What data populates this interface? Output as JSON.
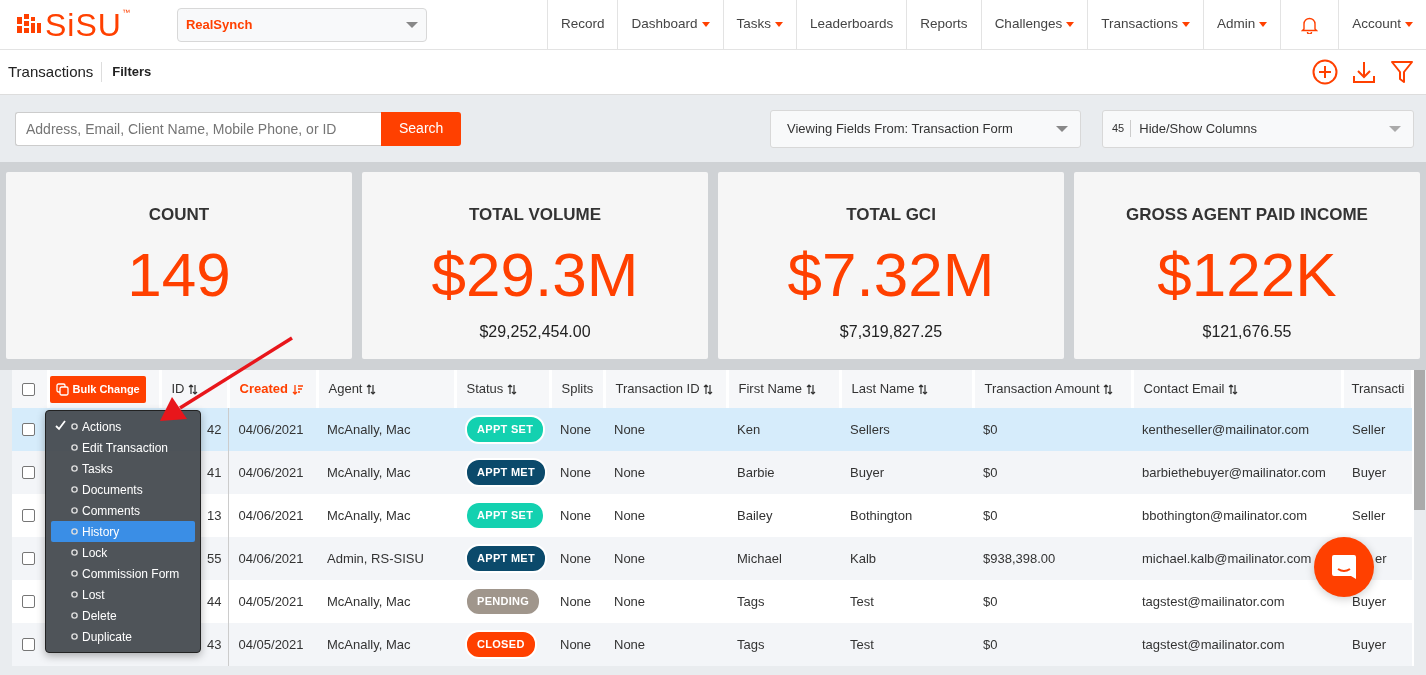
{
  "brand": {
    "logo": "SiSU",
    "trademark": "™"
  },
  "org_select": {
    "value": "RealSynch"
  },
  "nav": [
    {
      "label": "Record",
      "dropdown": false
    },
    {
      "label": "Dashboard",
      "dropdown": true
    },
    {
      "label": "Tasks",
      "dropdown": true
    },
    {
      "label": "Leaderboards",
      "dropdown": false
    },
    {
      "label": "Reports",
      "dropdown": false
    },
    {
      "label": "Challenges",
      "dropdown": true
    },
    {
      "label": "Transactions",
      "dropdown": true
    },
    {
      "label": "Admin",
      "dropdown": true
    },
    {
      "kind": "bell"
    },
    {
      "label": "Account",
      "dropdown": true
    }
  ],
  "subheader": {
    "title": "Transactions",
    "filters": "Filters"
  },
  "search": {
    "placeholder": "Address, Email, Client Name, Mobile Phone, or ID",
    "button": "Search"
  },
  "view_select": {
    "value": "Viewing Fields From: Transaction Form"
  },
  "columns_select": {
    "count": "45",
    "value": "Hide/Show Columns"
  },
  "stats": [
    {
      "label": "COUNT",
      "value": "149"
    },
    {
      "label": "TOTAL VOLUME",
      "value": "$29.3M",
      "detail": "$29,252,454.00"
    },
    {
      "label": "TOTAL GCI",
      "value": "$7.32M",
      "detail": "$7,319,827.25"
    },
    {
      "label": "GROSS AGENT PAID INCOME",
      "value": "$122K",
      "detail": "$121,676.55"
    }
  ],
  "table": {
    "select_all_checked": false,
    "bulk_button": "Bulk Change",
    "columns": [
      {
        "label": "ID",
        "sortable": true,
        "sorted": false
      },
      {
        "label": "Created",
        "sortable": true,
        "sorted": true
      },
      {
        "label": "Agent",
        "sortable": true,
        "sorted": false
      },
      {
        "label": "Status",
        "sortable": true,
        "sorted": false
      },
      {
        "label": "Splits",
        "sortable": false,
        "sorted": false
      },
      {
        "label": "Transaction ID",
        "sortable": true,
        "sorted": false
      },
      {
        "label": "First Name",
        "sortable": true,
        "sorted": false
      },
      {
        "label": "Last Name",
        "sortable": true,
        "sorted": false
      },
      {
        "label": "Transaction Amount",
        "sortable": true,
        "sorted": false
      },
      {
        "label": "Contact Email",
        "sortable": true,
        "sorted": false
      },
      {
        "label": "Transacti",
        "sortable": false,
        "sorted": false
      }
    ],
    "rows": [
      {
        "selected": true,
        "checked": false,
        "cells": [
          "42",
          "04/06/2021",
          "McAnally, Mac",
          {
            "label": "APPT SET",
            "color": "#13d1b0"
          },
          "None",
          "None",
          "Ken",
          "Sellers",
          "$0",
          "kentheseller@mailinator.com",
          "Seller"
        ]
      },
      {
        "selected": false,
        "checked": false,
        "cells": [
          "41",
          "04/06/2021",
          "McAnally, Mac",
          {
            "label": "APPT MET",
            "color": "#0b4a6b"
          },
          "None",
          "None",
          "Barbie",
          "Buyer",
          "$0",
          "barbiethebuyer@mailinator.com",
          "Buyer"
        ]
      },
      {
        "selected": false,
        "checked": false,
        "cells": [
          "13",
          "04/06/2021",
          "McAnally, Mac",
          {
            "label": "APPT SET",
            "color": "#13d1b0"
          },
          "None",
          "None",
          "Bailey",
          "Bothington",
          "$0",
          "bbothington@mailinator.com",
          "Seller"
        ]
      },
      {
        "selected": false,
        "checked": false,
        "cells": [
          "55",
          "04/06/2021",
          "Admin, RS-SISU",
          {
            "label": "APPT MET",
            "color": "#0b4a6b"
          },
          "None",
          "None",
          "Michael",
          "Kalb",
          "$938,398.00",
          "michael.kalb@mailinator.com",
          "er"
        ]
      },
      {
        "selected": false,
        "checked": false,
        "cells": [
          "44",
          "04/05/2021",
          "McAnally, Mac",
          {
            "label": "PENDING",
            "color": "#a0968c"
          },
          "None",
          "None",
          "Tags",
          "Test",
          "$0",
          "tagstest@mailinator.com",
          "Buyer"
        ]
      },
      {
        "selected": false,
        "checked": false,
        "cells": [
          "43",
          "04/05/2021",
          "McAnally, Mac",
          {
            "label": "CLOSED",
            "color": "#ff4000"
          },
          "None",
          "None",
          "Tags",
          "Test",
          "$0",
          "tagstest@mailinator.com",
          "Buyer"
        ]
      }
    ]
  },
  "actions_menu": [
    {
      "label": "Actions",
      "checked": true,
      "selected": false
    },
    {
      "label": "Edit Transaction",
      "checked": false,
      "selected": false
    },
    {
      "label": "Tasks",
      "checked": false,
      "selected": false
    },
    {
      "label": "Documents",
      "checked": false,
      "selected": false
    },
    {
      "label": "Comments",
      "checked": false,
      "selected": false
    },
    {
      "label": "History",
      "checked": false,
      "selected": true
    },
    {
      "label": "Lock",
      "checked": false,
      "selected": false
    },
    {
      "label": "Commission Form",
      "checked": false,
      "selected": false
    },
    {
      "label": "Lost",
      "checked": false,
      "selected": false
    },
    {
      "label": "Delete",
      "checked": false,
      "selected": false
    },
    {
      "label": "Duplicate",
      "checked": false,
      "selected": false
    }
  ]
}
